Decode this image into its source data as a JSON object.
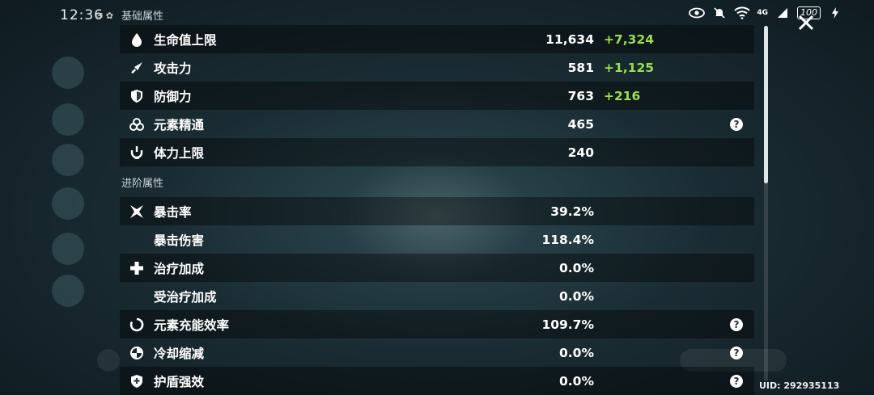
{
  "status_bar": {
    "time": "12:36",
    "notif": "✉ ✿",
    "network": "4G",
    "battery": "100"
  },
  "sections": {
    "base_title": "基础属性",
    "advanced_title": "进阶属性"
  },
  "base_stats": [
    {
      "label": "生命值上限",
      "value": "11,634",
      "bonus": "+7,324",
      "icon": "hp-drop-icon"
    },
    {
      "label": "攻击力",
      "value": "581",
      "bonus": "+1,125",
      "icon": "sword-icon"
    },
    {
      "label": "防御力",
      "value": "763",
      "bonus": "+216",
      "icon": "shield-icon"
    },
    {
      "label": "元素精通",
      "value": "465",
      "bonus": "",
      "icon": "elemental-mastery-icon",
      "help": "?"
    },
    {
      "label": "体力上限",
      "value": "240",
      "bonus": "",
      "icon": "stamina-icon"
    }
  ],
  "advanced_stats": [
    {
      "label": "暴击率",
      "value": "39.2%",
      "icon": "crit-rate-icon"
    },
    {
      "label": "暴击伤害",
      "value": "118.4%",
      "icon": ""
    },
    {
      "label": "治疗加成",
      "value": "0.0%",
      "icon": "healing-cross-icon"
    },
    {
      "label": "受治疗加成",
      "value": "0.0%",
      "icon": ""
    },
    {
      "label": "元素充能效率",
      "value": "109.7%",
      "icon": "energy-recharge-icon",
      "help": "?"
    },
    {
      "label": "冷却缩减",
      "value": "0.0%",
      "icon": "cooldown-icon",
      "help": "?"
    },
    {
      "label": "护盾强效",
      "value": "0.0%",
      "icon": "shield-strength-icon",
      "help": "?"
    }
  ],
  "uid": "UID: 292935113"
}
